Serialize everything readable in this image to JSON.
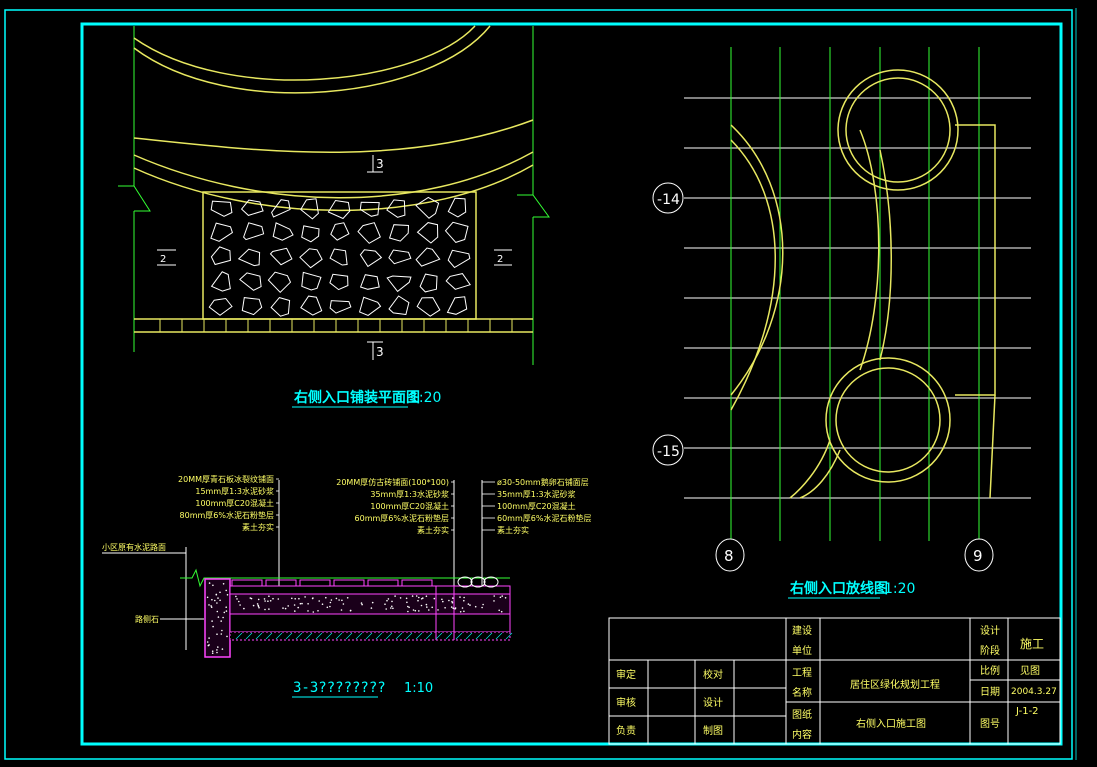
{
  "plan_view": {
    "title": "右侧入口铺装平面图",
    "scale": "1:20",
    "section_mark": "3",
    "side_mark": "2"
  },
  "setout_view": {
    "title": "右侧入口放线图",
    "scale": "1:20",
    "grid_row_a": "14",
    "grid_row_b": "15",
    "grid_col_a": "8",
    "grid_col_b": "9"
  },
  "section_view": {
    "title": "3-3????????",
    "scale": "1:10",
    "left_labels": [
      "20MM厚青石板冰裂纹铺面",
      "15mm厚1:3水泥砂浆",
      "100mm厚C20混凝土",
      "80mm厚6%水泥石粉垫层",
      "素土夯实"
    ],
    "middle_labels": [
      "20MM厚仿古砖铺面(100*100)",
      "35mm厚1:3水泥砂浆",
      "100mm厚C20混凝土",
      "60mm厚6%水泥石粉垫层",
      "素土夯实"
    ],
    "right_labels": [
      "ø30-50mm鹅卵石铺面层",
      "35mm厚1:3水泥砂浆",
      "100mm厚C20混凝土",
      "60mm厚6%水泥石粉垫层",
      "素土夯实"
    ],
    "kerb_top_label": "小区原有水泥路面",
    "kerb_label": "路侧石"
  },
  "title_block": {
    "review": "审定",
    "check": "审核",
    "proofread": "校对",
    "design": "设计",
    "charge": "负责",
    "draw": "制图",
    "unit_label": "单位",
    "unit_label_top": "建设",
    "project_label_top": "工程",
    "project_label": "名称",
    "drawing_label_top": "图纸",
    "drawing_label": "内容",
    "project_name": "居住区绿化规划工程",
    "drawing_name": "右侧入口施工图",
    "stage_label_top": "设计",
    "stage_label": "阶段",
    "stage_value": "施工",
    "scale_label": "比例",
    "scale_value": "见图",
    "date_label": "日期",
    "date_value": "2004.3.27",
    "number_label": "图号",
    "number_value": "J-1-2"
  },
  "colors": {
    "frame": "#00ffff",
    "grid": "#33ff33",
    "curves": "#ffff66",
    "dim_lines": "#ffffff",
    "hatch": "#ff44ff"
  }
}
